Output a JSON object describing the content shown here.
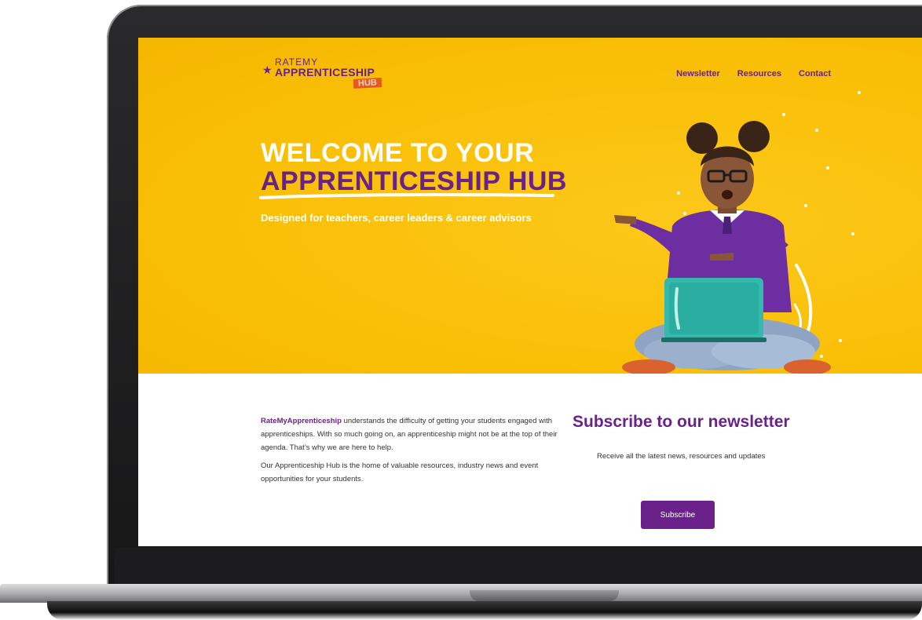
{
  "logo": {
    "star": "★",
    "top": "RATEMY",
    "main": "APPRENTICESHIP",
    "tag": "HUB"
  },
  "nav": {
    "items": [
      "Newsletter",
      "Resources",
      "Contact"
    ]
  },
  "hero": {
    "title_line1": "WELCOME TO YOUR",
    "title_line2": "APPRENTICESHIP HUB",
    "subtitle": "Designed for teachers, career leaders & career advisors"
  },
  "intro": {
    "brand": "RateMyApprenticeship",
    "p1_rest": " understands the difficulty of getting your students engaged with apprenticeships. With so much going on, an apprenticeship might not be at the top of their agenda. That’s why we are here to help.",
    "p2": "Our Apprenticeship Hub is the home of valuable resources, industry news and event opportunities for your students."
  },
  "newsletter": {
    "title": "Subscribe to our newsletter",
    "description": "Receive all the latest news, resources and updates",
    "button": "Subscribe"
  },
  "colors": {
    "brand_purple": "#6a2189",
    "hero_yellow": "#f9bf06",
    "hub_orange": "#e8571f"
  }
}
